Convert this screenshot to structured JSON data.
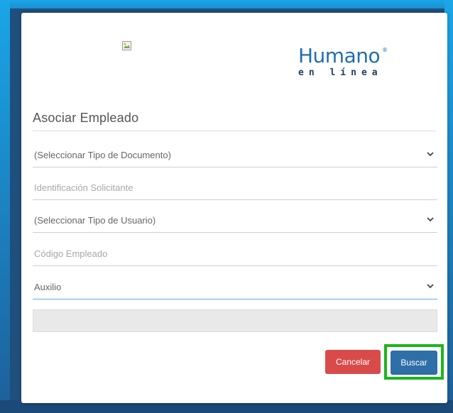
{
  "logo": {
    "word": "Humano",
    "reg": "®",
    "sub": "en línea"
  },
  "form": {
    "title": "Asociar Empleado",
    "fields": [
      {
        "text": "(Seleccionar Tipo de Documento)",
        "kind": "select"
      },
      {
        "text": "Identificación Solicitante",
        "kind": "input-placeholder"
      },
      {
        "text": "(Seleccionar Tipo de Usuario)",
        "kind": "select"
      },
      {
        "text": "Código Empleado",
        "kind": "input-placeholder"
      },
      {
        "text": "Auxilio",
        "kind": "select"
      }
    ],
    "cancel_label": "Cancelar",
    "search_label": "Buscar"
  },
  "colors": {
    "cancel": "#d94b4b",
    "search": "#2e6fa8",
    "highlight": "#1cb51c",
    "brand": "#1f6fae"
  },
  "icons": [
    "broken-image-icon",
    "chevron-down-icon"
  ]
}
